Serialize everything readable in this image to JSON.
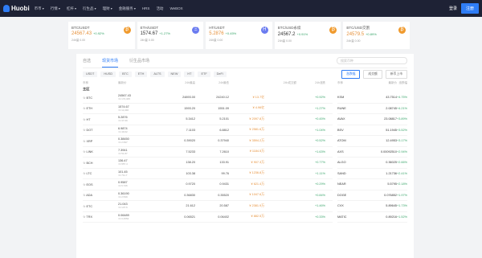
{
  "brand": "Huobi",
  "nav": [
    "币币",
    "行情",
    "杠杆",
    "衍生品",
    "理财",
    "金融服务",
    "HRS",
    "活动",
    "WeBOX"
  ],
  "login": "登录",
  "register": "注册",
  "tickers": [
    {
      "name": "BTC/USDT",
      "price": "24567.43",
      "change": "+0.92%",
      "vol": "24h量 0.00",
      "icon": "₿",
      "color": "o"
    },
    {
      "name": "ETH/USDT",
      "price": "1574.67",
      "change": "+1.27%",
      "vol": "24h量 0.00",
      "icon": "Ξ",
      "color": "b"
    },
    {
      "name": "HT/USDT",
      "price": "5.2876",
      "change": "+0.45%",
      "vol": "24h量 0.00",
      "icon": "H",
      "color": "b"
    },
    {
      "name": "BTC/USD永续",
      "price": "24567.2",
      "change": "+0.91%",
      "vol": "24h量 0.00",
      "icon": "₿",
      "color": "o"
    },
    {
      "name": "BTC/USD交割",
      "price": "24579.5",
      "change": "+0.89%",
      "vol": "24h量 0.00",
      "icon": "₿",
      "color": "o"
    }
  ],
  "tabs": [
    "自选",
    "现货市场",
    "衍生品市场"
  ],
  "search_placeholder": "搜索币种",
  "filters": [
    "USDT",
    "HUSD",
    "BTC",
    "ETH",
    "ALTS",
    "NEW",
    "HT",
    "ETF",
    "DeFi"
  ],
  "right_btns": [
    "涨跌幅",
    "成交额",
    "新币上市"
  ],
  "headers": [
    "币种",
    "最新价",
    "24h最高",
    "24h最低",
    "24h成交额",
    "24h涨跌"
  ],
  "section": "主区",
  "rows": [
    {
      "coin": "BTC",
      "price": "24567.43",
      "cny": "≈¥ 172,345",
      "hi": "24893.00",
      "lo": "24240.12",
      "amt": "¥ 13.7亿",
      "chg": "+0.92%"
    },
    {
      "coin": "ETH",
      "price": "1574.67",
      "cny": "≈¥ 11,046",
      "hi": "1593.20",
      "lo": "1551.09",
      "amt": "¥ 4.96亿",
      "chg": "+1.27%"
    },
    {
      "coin": "HT",
      "price": "5.2876",
      "cny": "≈¥ 37.09",
      "hi": "5.3412",
      "lo": "5.2101",
      "amt": "¥ 2097.8万",
      "chg": "+0.45%"
    },
    {
      "coin": "DOT",
      "price": "6.9874",
      "cny": "≈¥ 49.02",
      "hi": "7.1103",
      "lo": "6.8812",
      "amt": "¥ 2581.6万",
      "chg": "+1.04%"
    },
    {
      "coin": "XRP",
      "price": "0.38450",
      "cny": "≈¥ 2.697",
      "hi": "0.39020",
      "lo": "0.37940",
      "amt": "¥ 3594.2万",
      "chg": "+0.52%"
    },
    {
      "coin": "LINK",
      "price": "7.3941",
      "cny": "≈¥ 51.87",
      "hi": "7.5233",
      "lo": "7.2610",
      "amt": "¥ 1184.5万",
      "chg": "+1.63%"
    },
    {
      "coin": "BCH",
      "price": "136.47",
      "cny": "≈¥ 957.4",
      "hi": "138.20",
      "lo": "133.91",
      "amt": "¥ 907.3万",
      "chg": "+0.77%"
    },
    {
      "coin": "LTC",
      "price": "101.45",
      "cny": "≈¥ 711.7",
      "hi": "103.38",
      "lo": "99.76",
      "amt": "¥ 1236.8万",
      "chg": "+1.11%"
    },
    {
      "coin": "EOS",
      "price": "0.9587",
      "cny": "≈¥ 6.726",
      "hi": "0.9720",
      "lo": "0.9431",
      "amt": "¥ 621.4万",
      "chg": "+0.29%"
    },
    {
      "coin": "ADA",
      "price": "0.36190",
      "cny": "≈¥ 2.539",
      "hi": "0.36830",
      "lo": "0.35520",
      "amt": "¥ 1047.6万",
      "chg": "+0.84%"
    },
    {
      "coin": "ETC",
      "price": "21.043",
      "cny": "≈¥ 147.6",
      "hi": "21.612",
      "lo": "20.587",
      "amt": "¥ 2381.9万",
      "chg": "+1.46%"
    },
    {
      "coin": "TRX",
      "price": "0.06489",
      "cny": "≈¥ 0.4552",
      "hi": "0.06521",
      "lo": "0.06402",
      "amt": "¥ 882.5万",
      "chg": "+0.33%"
    }
  ],
  "right_headers": [
    "币种",
    "最新价",
    "涨跌幅"
  ],
  "right_rows": [
    {
      "coin": "KSM",
      "price": "43.7514",
      "chg": "+4.75%"
    },
    {
      "coin": "RUNE",
      "price": "2.08745",
      "chg": "+4.21%"
    },
    {
      "coin": "AVAX",
      "price": "23.08817",
      "chg": "+3.89%"
    },
    {
      "coin": "BSV",
      "price": "51.1945",
      "chg": "+3.52%"
    },
    {
      "coin": "ATOM",
      "price": "12.4953",
      "chg": "+3.17%"
    },
    {
      "coin": "AXS",
      "price": "0.00092510",
      "chg": "+2.94%"
    },
    {
      "coin": "ALGO",
      "price": "0.36025",
      "chg": "+2.66%"
    },
    {
      "coin": "SAND",
      "price": "1.21736",
      "chg": "+2.41%"
    },
    {
      "coin": "NEAR",
      "price": "5.5795",
      "chg": "+2.18%"
    },
    {
      "coin": "DOGE",
      "price": "0.076852",
      "chg": "+1.97%"
    },
    {
      "coin": "CVX",
      "price": "5.89645",
      "chg": "+1.73%"
    },
    {
      "coin": "MATIC",
      "price": "0.89216",
      "chg": "+1.52%"
    }
  ]
}
